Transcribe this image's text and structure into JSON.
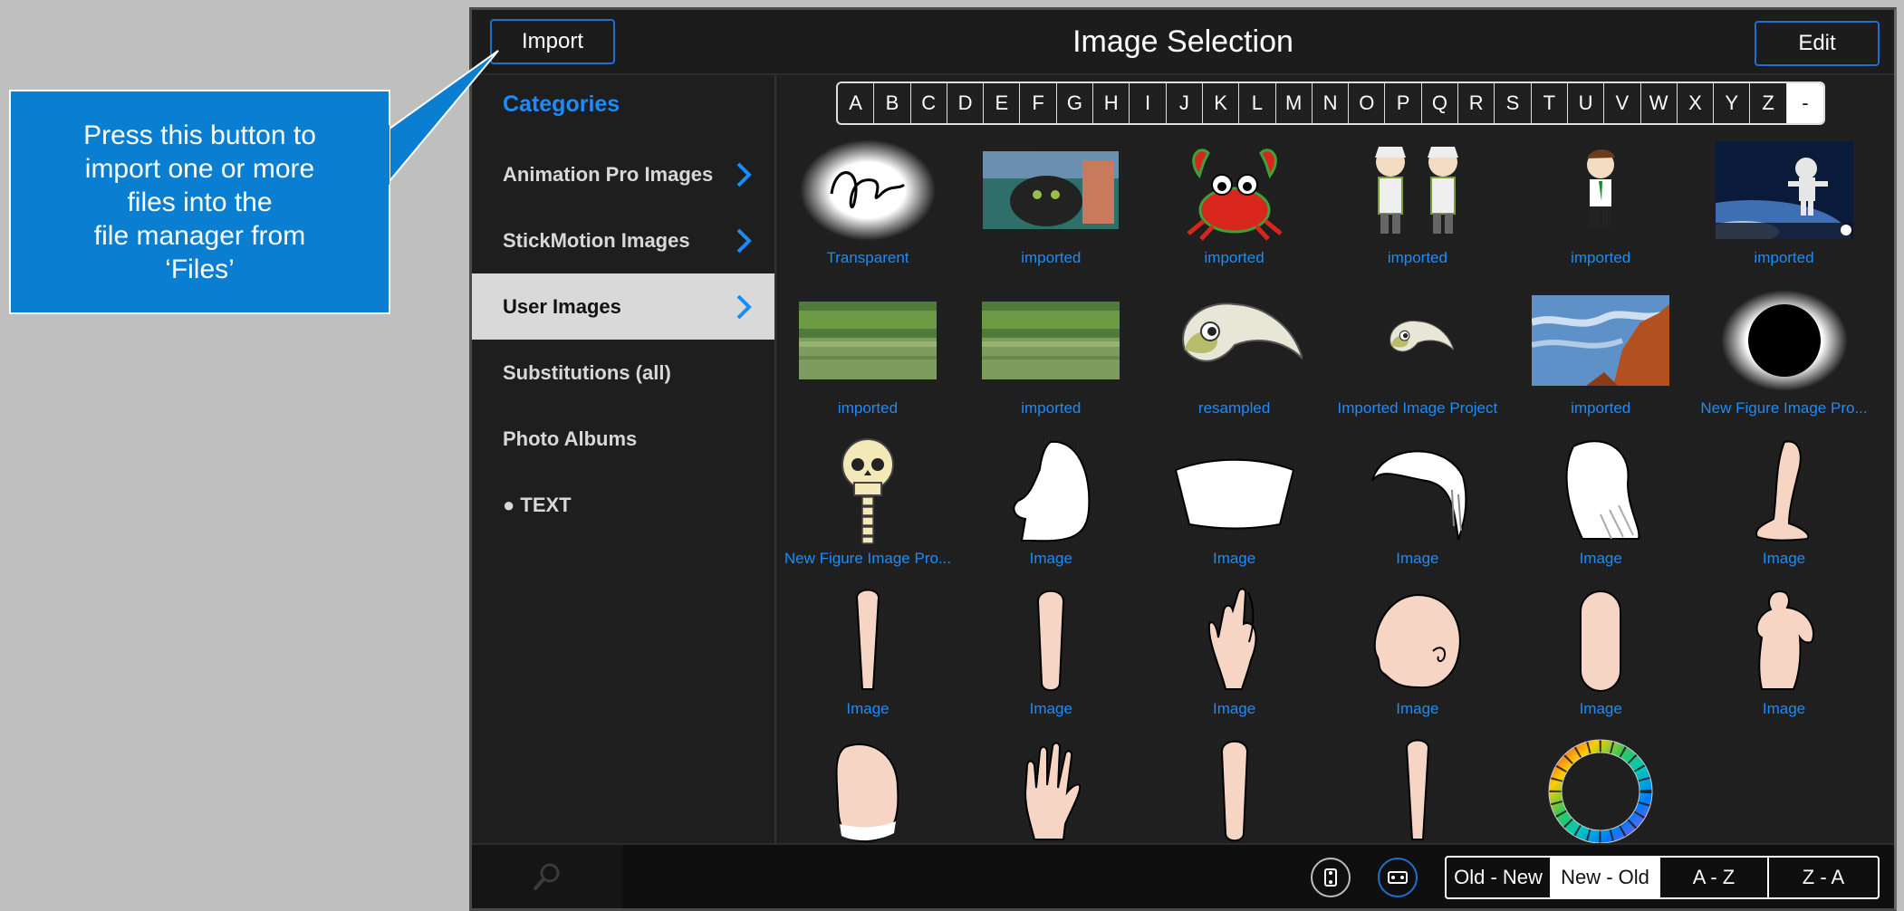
{
  "callout": {
    "text": "Press this button to\nimport one or more\nfiles into the\nfile manager from\n‘Files’"
  },
  "header": {
    "import_label": "Import",
    "title": "Image Selection",
    "edit_label": "Edit"
  },
  "sidebar": {
    "title": "Categories",
    "items": [
      {
        "label": "Animation Pro Images",
        "chevron": true,
        "active": false
      },
      {
        "label": "StickMotion Images",
        "chevron": true,
        "active": false
      },
      {
        "label": "User Images",
        "chevron": true,
        "active": true
      },
      {
        "label": "Substitutions (all)",
        "chevron": false,
        "active": false
      },
      {
        "label": "Photo Albums",
        "chevron": false,
        "active": false
      },
      {
        "label": "● TEXT",
        "chevron": false,
        "active": false
      }
    ]
  },
  "alphabet": [
    "A",
    "B",
    "C",
    "D",
    "E",
    "F",
    "G",
    "H",
    "I",
    "J",
    "K",
    "L",
    "M",
    "N",
    "O",
    "P",
    "Q",
    "R",
    "S",
    "T",
    "U",
    "V",
    "W",
    "X",
    "Y",
    "Z",
    "-"
  ],
  "images": [
    {
      "caption": "Transparent",
      "icon": "signature-icon"
    },
    {
      "caption": "imported",
      "icon": "cat-photo-icon"
    },
    {
      "caption": "imported",
      "icon": "crab-icon"
    },
    {
      "caption": "imported",
      "icon": "old-men-icon"
    },
    {
      "caption": "imported",
      "icon": "cartoon-man-icon"
    },
    {
      "caption": "imported",
      "icon": "astronaut-icon"
    },
    {
      "caption": "imported",
      "icon": "river-photo-icon"
    },
    {
      "caption": "imported",
      "icon": "river-photo-icon"
    },
    {
      "caption": "resampled",
      "icon": "bird-head-icon"
    },
    {
      "caption": "Imported Image Project",
      "icon": "bird-head-small-icon"
    },
    {
      "caption": "imported",
      "icon": "sky-photo-icon"
    },
    {
      "caption": "New Figure Image Pro...",
      "icon": "black-circle-icon"
    },
    {
      "caption": "New Figure Image Pro...",
      "icon": "skeleton-icon"
    },
    {
      "caption": "Image",
      "icon": "head-profile-icon"
    },
    {
      "caption": "Image",
      "icon": "torso-shape-icon"
    },
    {
      "caption": "Image",
      "icon": "hair-icon"
    },
    {
      "caption": "Image",
      "icon": "hair-long-icon"
    },
    {
      "caption": "Image",
      "icon": "foot-icon"
    },
    {
      "caption": "Image",
      "icon": "limb-thin-icon"
    },
    {
      "caption": "Image",
      "icon": "limb-icon"
    },
    {
      "caption": "Image",
      "icon": "hand-side-icon"
    },
    {
      "caption": "Image",
      "icon": "head-icon"
    },
    {
      "caption": "Image",
      "icon": "limb-rounded-icon"
    },
    {
      "caption": "Image",
      "icon": "body-icon"
    },
    {
      "caption": "",
      "icon": "palm-icon"
    },
    {
      "caption": "",
      "icon": "hand-icon"
    },
    {
      "caption": "",
      "icon": "limb-icon"
    },
    {
      "caption": "",
      "icon": "limb-thin-icon"
    },
    {
      "caption": "",
      "icon": "color-wheel-icon"
    }
  ],
  "sort": {
    "options": [
      "Old - New",
      "New - Old",
      "A - Z",
      "Z - A"
    ],
    "selected": "New - Old"
  },
  "colors": {
    "accent": "#1a8cff",
    "callout": "#0a7fd1",
    "background": "#1e1e1e"
  }
}
